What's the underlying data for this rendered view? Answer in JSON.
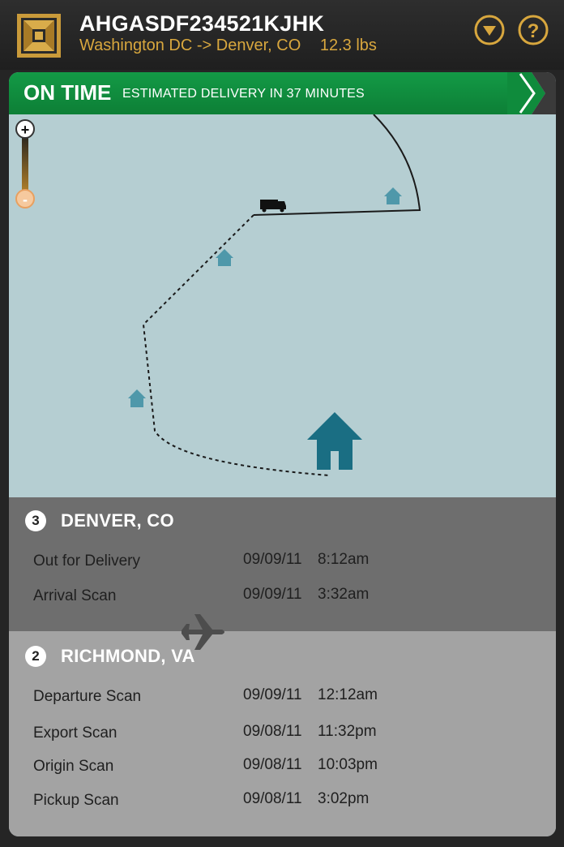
{
  "header": {
    "tracking_number": "AHGASDF234521KJHK",
    "origin": "Washington DC",
    "arrow": "->",
    "destination": "Denver, CO",
    "weight": "12.3 lbs",
    "menu_icon": "chevron-down-circle-icon",
    "help_icon": "question-circle-icon",
    "accent_color": "#d8a73e"
  },
  "status": {
    "title": "ON TIME",
    "subtitle": "ESTIMATED DELIVERY IN 37 MINUTES",
    "color": "#139a46"
  },
  "map": {
    "zoom_in_label": "+",
    "zoom_out_label": "-",
    "icons": [
      "truck-icon",
      "house-icon",
      "destination-house-icon"
    ]
  },
  "locations": [
    {
      "number": "3",
      "city": "DENVER, CO",
      "events": [
        {
          "label": "Out for Delivery",
          "date": "09/09/11",
          "time": "8:12am"
        },
        {
          "label": "Arrival Scan",
          "date": "09/09/11",
          "time": "3:32am"
        }
      ]
    },
    {
      "number": "2",
      "city": "RICHMOND, VA",
      "events": [
        {
          "label": "Departure Scan",
          "date": "09/09/11",
          "time": "12:12am"
        },
        {
          "label": "Export Scan",
          "date": "09/08/11",
          "time": "11:32pm"
        },
        {
          "label": "Origin Scan",
          "date": "09/08/11",
          "time": "10:03pm"
        },
        {
          "label": "Pickup Scan",
          "date": "09/08/11",
          "time": "3:02pm"
        }
      ]
    }
  ]
}
